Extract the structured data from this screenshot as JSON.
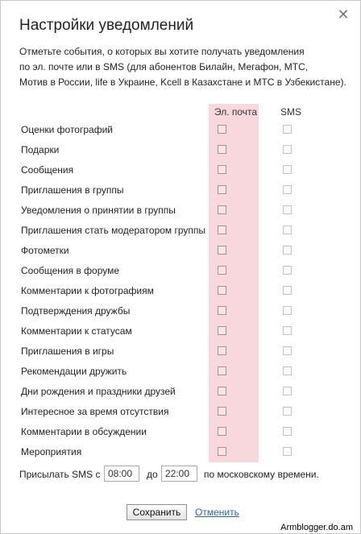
{
  "dialog": {
    "title": "Настройки уведомлений",
    "close_symbol": "✕",
    "description": [
      "Отметьте события, о которых вы хотите получать уведомления",
      "по эл. почте или в SMS (для абонентов Билайн, Мегафон, МТС,",
      "Мотив в России, life в Украине, Kcell в Казахстане и МТС в Узбекистане)."
    ]
  },
  "columns": {
    "email": "Эл. почта",
    "sms": "SMS"
  },
  "accent_colors": {
    "email_column_band": "#f9d8dd",
    "link": "#2f64b5"
  },
  "events": [
    {
      "label": "Оценки фотографий",
      "email": false,
      "sms": false
    },
    {
      "label": "Подарки",
      "email": false,
      "sms": false
    },
    {
      "label": "Сообщения",
      "email": false,
      "sms": false
    },
    {
      "label": "Приглашения в группы",
      "email": false,
      "sms": false
    },
    {
      "label": "Уведомления о принятии в группы",
      "email": false,
      "sms": false
    },
    {
      "label": "Приглашения стать модератором группы",
      "email": false,
      "sms": false
    },
    {
      "label": "Фотометки",
      "email": false,
      "sms": false
    },
    {
      "label": "Сообщения в форуме",
      "email": false,
      "sms": false
    },
    {
      "label": "Комментарии к фотографиям",
      "email": false,
      "sms": false
    },
    {
      "label": "Подтверждения дружбы",
      "email": false,
      "sms": false
    },
    {
      "label": "Комментарии к статусам",
      "email": false,
      "sms": false
    },
    {
      "label": "Приглашения в игры",
      "email": false,
      "sms": false
    },
    {
      "label": "Рекомендации дружить",
      "email": false,
      "sms": false
    },
    {
      "label": "Дни рождения и праздники друзей",
      "email": false,
      "sms": false
    },
    {
      "label": "Интересное за время отсутствия",
      "email": false,
      "sms": false
    },
    {
      "label": "Комментарии в обсуждении",
      "email": false,
      "sms": false
    },
    {
      "label": "Мероприятия",
      "email": false,
      "sms": false
    }
  ],
  "sms_time": {
    "prefix": "Присылать SMS с",
    "from_value": "08:00",
    "to_label": "до",
    "to_value": "22:00",
    "suffix": "по московскому времени."
  },
  "actions": {
    "save_label": "Сохранить",
    "cancel_label": "Отменить"
  },
  "watermark": "Armblogger.do.am"
}
